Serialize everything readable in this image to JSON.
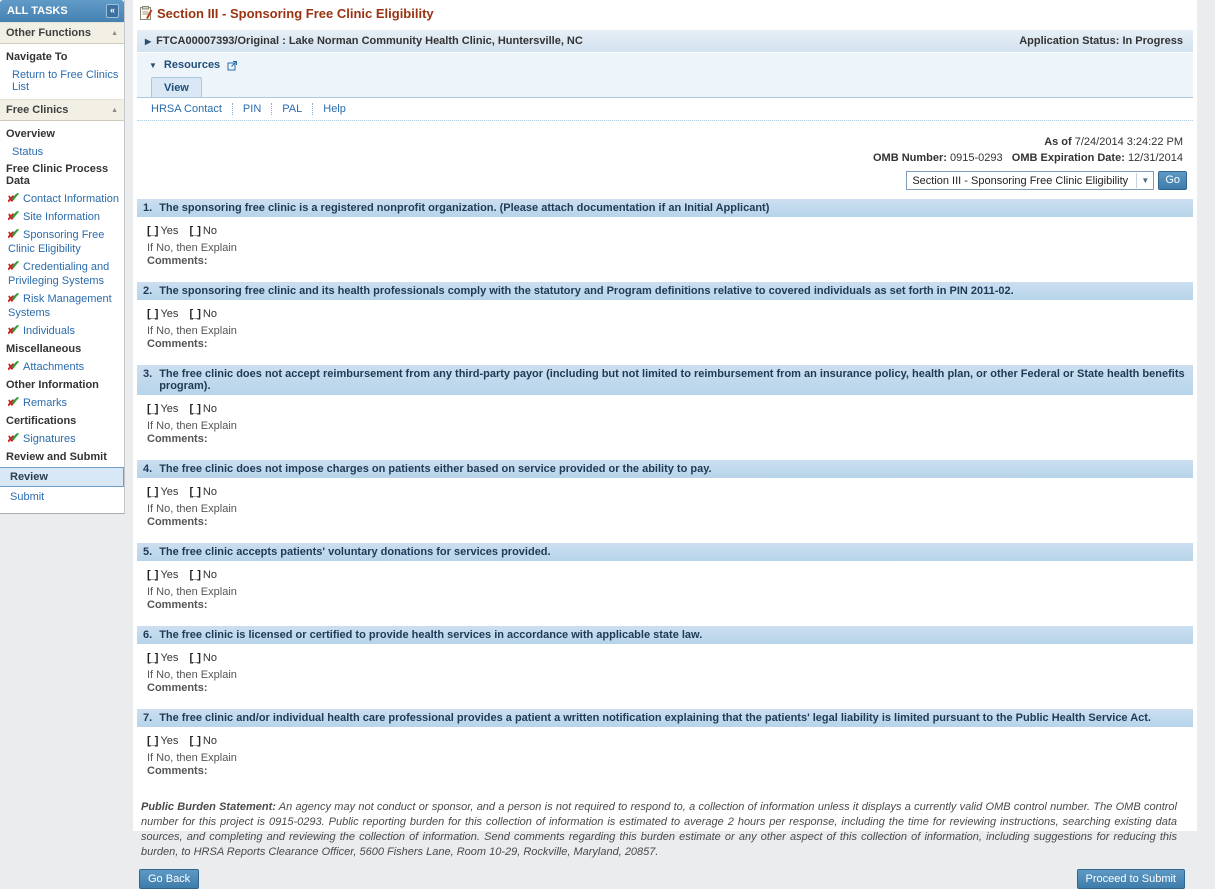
{
  "sidebar": {
    "title": "ALL TASKS",
    "collapse_label": "«",
    "items": [
      {
        "label": "Other Functions",
        "type": "section"
      },
      {
        "label": "Navigate To",
        "type": "group"
      },
      {
        "label": "Return to Free Clinics List",
        "type": "link"
      },
      {
        "label": "Free Clinics",
        "type": "section"
      },
      {
        "label": "Overview",
        "type": "group"
      },
      {
        "label": "Status",
        "type": "link"
      },
      {
        "label": "Free Clinic Process Data",
        "type": "group"
      },
      {
        "label": "Contact Information",
        "type": "check-link"
      },
      {
        "label": "Site Information",
        "type": "check-link"
      },
      {
        "label": "Sponsoring Free Clinic Eligibility",
        "type": "check-link"
      },
      {
        "label": "Credentialing and Privileging Systems",
        "type": "check-link"
      },
      {
        "label": "Risk Management Systems",
        "type": "check-link"
      },
      {
        "label": "Individuals",
        "type": "check-link"
      },
      {
        "label": "Miscellaneous",
        "type": "group"
      },
      {
        "label": "Attachments",
        "type": "check-link"
      },
      {
        "label": "Other Information",
        "type": "group"
      },
      {
        "label": "Remarks",
        "type": "check-link"
      },
      {
        "label": "Certifications",
        "type": "group"
      },
      {
        "label": "Signatures",
        "type": "check-link"
      },
      {
        "label": "Review and Submit",
        "type": "group"
      },
      {
        "label": "Review",
        "type": "selected"
      },
      {
        "label": "Submit",
        "type": "link"
      }
    ]
  },
  "page": {
    "title": "Section III - Sponsoring Free Clinic Eligibility"
  },
  "app_bar": {
    "application_id": "FTCA00007393/Original : Lake Norman Community Health Clinic, Huntersville, NC",
    "status": "Application Status: In Progress"
  },
  "resources": {
    "label": "Resources",
    "tab": "View",
    "links": [
      "HRSA Contact",
      "PIN",
      "PAL",
      "Help"
    ]
  },
  "meta": {
    "as_of_label": "As of",
    "as_of_value": "7/24/2014 3:24:22 PM",
    "omb_number_label": "OMB Number:",
    "omb_number": "0915-0293",
    "omb_exp_label": "OMB Expiration Date:",
    "omb_exp": "12/31/2014"
  },
  "section_nav": {
    "selected": "Section III - Sponsoring Free Clinic Eligibility",
    "go_label": "Go"
  },
  "form": {
    "checkbox_glyph": "[_]",
    "yes_label": "Yes",
    "no_label": "No",
    "if_no_label": "If No, then Explain",
    "comments_label": "Comments:",
    "questions": [
      {
        "number": "1.",
        "text": "The sponsoring free clinic is a registered nonprofit organization. (Please attach documentation if an Initial Applicant)"
      },
      {
        "number": "2.",
        "text": "The sponsoring free clinic and its health professionals comply with the statutory and Program definitions relative to covered individuals as set forth in PIN 2011-02."
      },
      {
        "number": "3.",
        "text": "The free clinic does not accept reimbursement from any third-party payor (including but not limited to reimbursement from an insurance policy, health plan, or other Federal or State health benefits program)."
      },
      {
        "number": "4.",
        "text": "The free clinic does not impose charges on patients either based on service provided or the ability to pay."
      },
      {
        "number": "5.",
        "text": "The free clinic accepts patients' voluntary donations for services provided."
      },
      {
        "number": "6.",
        "text": "The free clinic is licensed or certified to provide health services in accordance with applicable state law."
      },
      {
        "number": "7.",
        "text": "The free clinic and/or individual health care professional provides a patient a written notification explaining that the patients' legal liability is limited pursuant to the Public Health Service Act."
      }
    ]
  },
  "burden": {
    "label": "Public Burden Statement:",
    "text": " An agency may not conduct or sponsor, and a person is not required to respond to, a collection of information unless it displays a currently valid OMB control number. The OMB control number for this project is 0915-0293. Public reporting burden for this collection of information is estimated to average 2 hours per response, including the time for reviewing instructions, searching existing data sources, and completing and reviewing the collection of information. Send comments regarding this burden estimate or any other aspect of this collection of information, including suggestions for reducing this burden, to HRSA Reports Clearance Officer, 5600 Fishers Lane, Room 10-29, Rockville, Maryland, 20857."
  },
  "footer": {
    "go_back": "Go Back",
    "proceed": "Proceed to Submit"
  },
  "colors": {
    "accent_blue": "#4581b1",
    "title_maroon": "#993312",
    "question_bar_blue": "#b6d4ea",
    "link_blue": "#2a6cad",
    "check_green": "#2f9e3b",
    "x_red": "#cc2626"
  }
}
